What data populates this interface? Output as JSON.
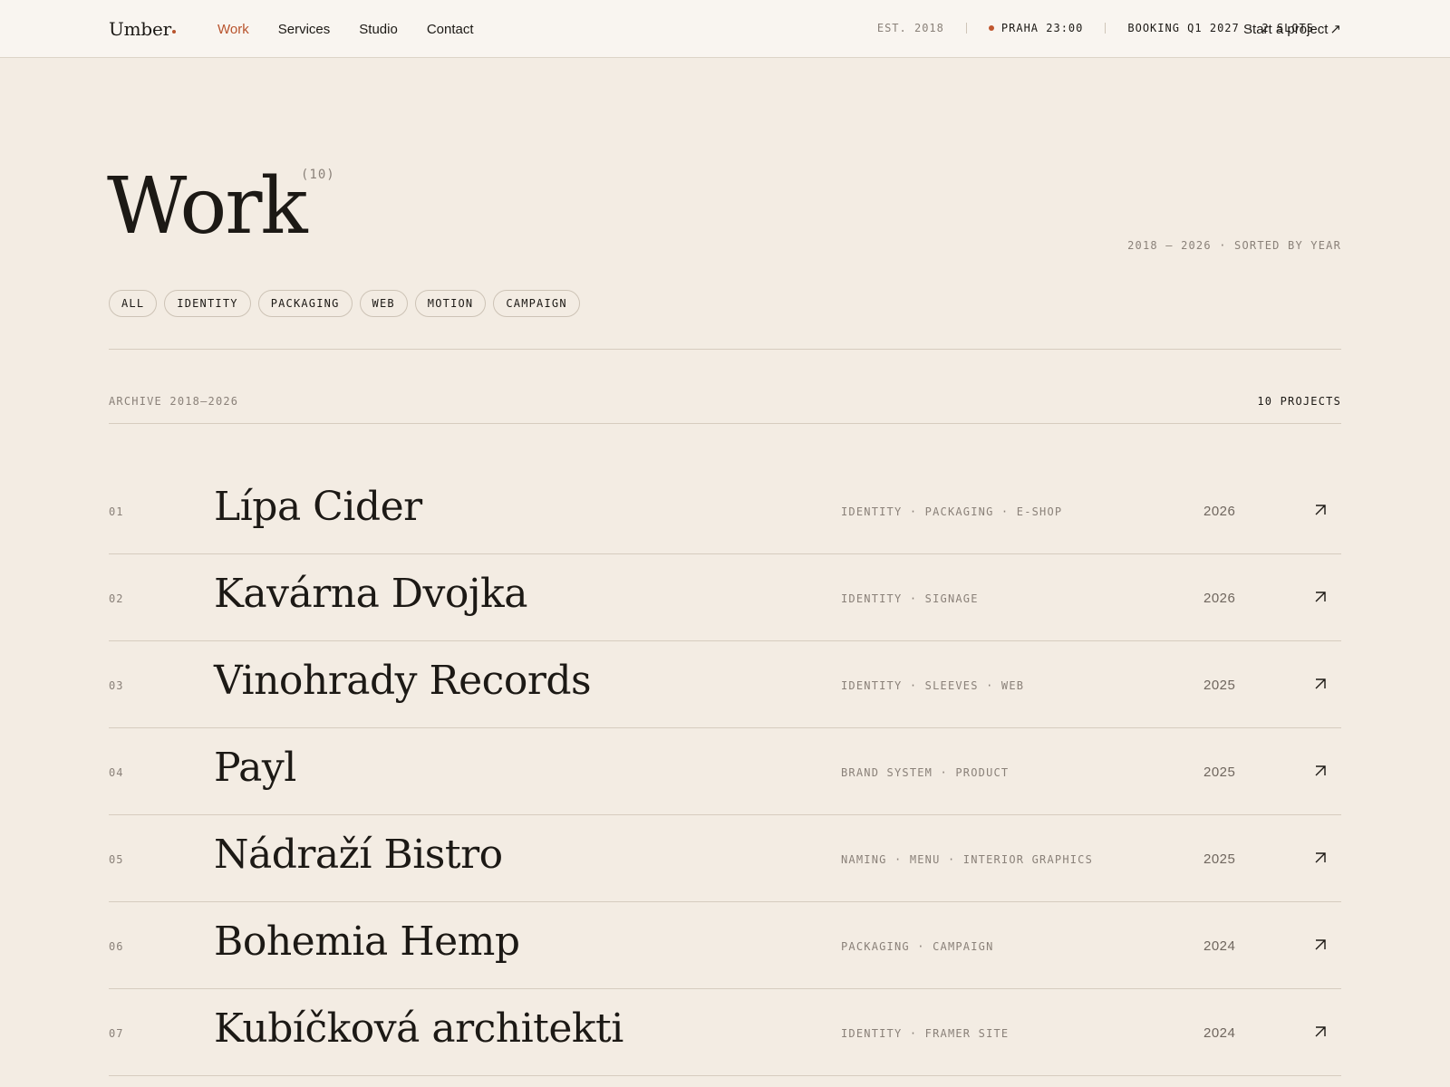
{
  "header": {
    "logo": "Umber",
    "nav": [
      {
        "label": "Work",
        "active": true
      },
      {
        "label": "Services",
        "active": false
      },
      {
        "label": "Studio",
        "active": false
      },
      {
        "label": "Contact",
        "active": false
      }
    ],
    "established": "EST. 2018",
    "location_time": "PRAHA 23:00",
    "booking": "BOOKING Q1 2027 · 2 SLOTS",
    "cta_label": "Start a project",
    "cta_icon": "arrow-up-right-icon",
    "accent_color": "#b8532c"
  },
  "hero": {
    "title": "Work",
    "count": "(10)",
    "range": "2018 — 2026 · SORTED BY YEAR"
  },
  "filters": [
    "ALL",
    "IDENTITY",
    "PACKAGING",
    "WEB",
    "MOTION",
    "CAMPAIGN"
  ],
  "archive": {
    "label": "ARCHIVE 2018–2026",
    "count": "10 PROJECTS"
  },
  "projects": [
    {
      "num": "01",
      "name": "Lípa Cider",
      "tags": "IDENTITY · PACKAGING · E-SHOP",
      "year": "2026"
    },
    {
      "num": "02",
      "name": "Kavárna Dvojka",
      "tags": "IDENTITY · SIGNAGE",
      "year": "2026"
    },
    {
      "num": "03",
      "name": "Vinohrady Records",
      "tags": "IDENTITY · SLEEVES · WEB",
      "year": "2025"
    },
    {
      "num": "04",
      "name": "Payl",
      "tags": "BRAND SYSTEM · PRODUCT",
      "year": "2025"
    },
    {
      "num": "05",
      "name": "Nádraží Bistro",
      "tags": "NAMING · MENU · INTERIOR GRAPHICS",
      "year": "2025"
    },
    {
      "num": "06",
      "name": "Bohemia Hemp",
      "tags": "PACKAGING · CAMPAIGN",
      "year": "2024"
    },
    {
      "num": "07",
      "name": "Kubíčková architekti",
      "tags": "IDENTITY · FRAMER SITE",
      "year": "2024"
    }
  ]
}
